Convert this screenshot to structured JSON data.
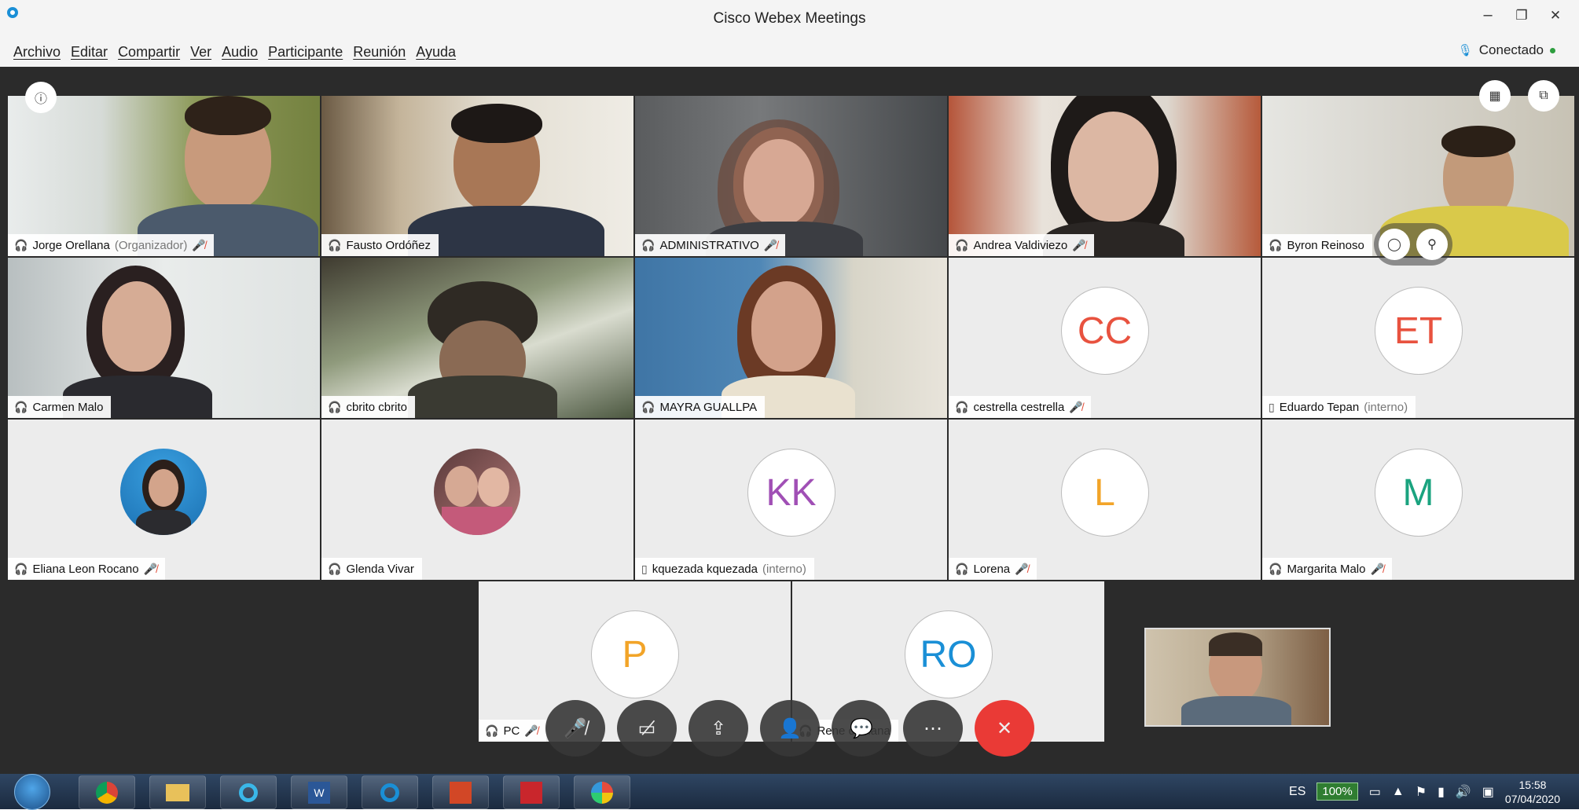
{
  "window": {
    "title": "Cisco Webex Meetings",
    "controls": [
      "–",
      "❐",
      "✕"
    ]
  },
  "menu": [
    "Archivo",
    "Editar",
    "Compartir",
    "Ver",
    "Audio",
    "Participante",
    "Reunión",
    "Ayuda"
  ],
  "status": {
    "label": "Conectado",
    "color": "#2e9e3f"
  },
  "participants": [
    {
      "name": "Jorge Orellana",
      "suffix": "(Organizador)",
      "video": true,
      "muted": true,
      "device": "audio"
    },
    {
      "name": "Fausto Ordóñez",
      "suffix": "",
      "video": true,
      "muted": false,
      "active_speaker": true,
      "device": "audio-speaking"
    },
    {
      "name": "ADMINISTRATIVO",
      "suffix": "",
      "video": true,
      "muted": true,
      "device": "audio"
    },
    {
      "name": "Andrea Valdiviezo",
      "suffix": "",
      "video": true,
      "muted": true,
      "device": "audio"
    },
    {
      "name": "Byron Reinoso",
      "suffix": "",
      "video": true,
      "muted": false,
      "device": "audio"
    },
    {
      "name": "Carmen Malo",
      "suffix": "",
      "video": true,
      "muted": false,
      "device": "audio"
    },
    {
      "name": "cbrito cbrito",
      "suffix": "",
      "video": true,
      "muted": false,
      "device": "audio"
    },
    {
      "name": "MAYRA GUALLPA",
      "suffix": "",
      "video": true,
      "muted": false,
      "device": "audio"
    },
    {
      "name": "cestrella cestrella",
      "suffix": "",
      "initials": "CC",
      "initials_color": "#e8523f",
      "muted": true,
      "device": "audio"
    },
    {
      "name": "Eduardo Tepan",
      "suffix": "(interno)",
      "initials": "ET",
      "initials_color": "#e8523f",
      "muted": false,
      "device": "phone"
    },
    {
      "name": "Eliana Leon Rocano",
      "suffix": "",
      "avatar": "photo",
      "muted": true,
      "device": "audio"
    },
    {
      "name": "Glenda Vivar",
      "suffix": "",
      "avatar": "photo",
      "muted": false,
      "device": "audio"
    },
    {
      "name": "kquezada kquezada",
      "suffix": "(interno)",
      "initials": "KK",
      "initials_color": "#a04fb5",
      "muted": false,
      "device": "phone"
    },
    {
      "name": "Lorena",
      "suffix": "",
      "initials": "L",
      "initials_color": "#f2a428",
      "muted": true,
      "device": "audio"
    },
    {
      "name": "Margarita Malo",
      "suffix": "",
      "initials": "M",
      "initials_color": "#1aa37f",
      "muted": true,
      "device": "audio"
    },
    {
      "name": "PC",
      "suffix": "",
      "initials": "P",
      "initials_color": "#f2a428",
      "muted": true,
      "device": "audio"
    },
    {
      "name": "Rene orellana",
      "suffix": "",
      "initials": "RO",
      "initials_color": "#1a8fd6",
      "muted": false,
      "device": "audio"
    }
  ],
  "toolbar": [
    "mute",
    "stop-video",
    "share",
    "participants",
    "chat",
    "more",
    "end"
  ],
  "taskbar": {
    "language": "ES",
    "battery": "100%",
    "time": "15:58",
    "date": "07/04/2020"
  }
}
